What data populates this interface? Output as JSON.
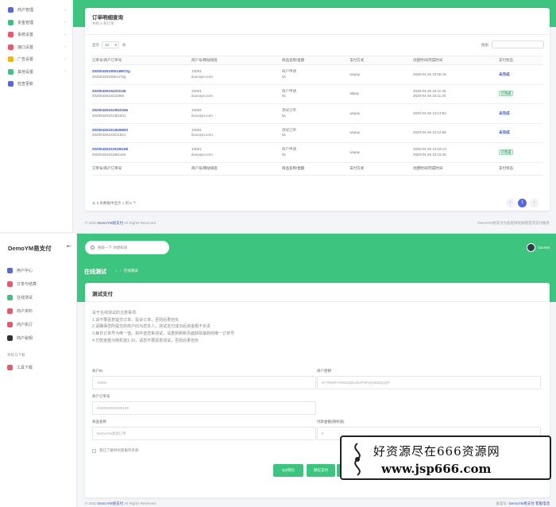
{
  "top_panel": {
    "sidebar": [
      {
        "label": "商户管理",
        "color": "#5867dd"
      },
      {
        "label": "资金管理",
        "color": "#3dc47e"
      },
      {
        "label": "系统设置",
        "color": "#e8596b"
      },
      {
        "label": "接口设置",
        "color": "#e8596b"
      },
      {
        "label": "广告设置",
        "color": "#f4b400"
      },
      {
        "label": "其他设置",
        "color": "#3dc47e"
      },
      {
        "label": "检查更新",
        "color": "#5867dd"
      }
    ],
    "card": {
      "title": "订单明细查询",
      "subtitle": "共有 5 条订单",
      "show_label": "显示",
      "page_size": "10",
      "entries_label": "条",
      "search_label": "搜索:"
    },
    "table": {
      "headers": [
        "订单号/商户订单号",
        "商户号/网站域名",
        "商品名称/金额",
        "支付方式",
        "创建时间/完成时间",
        "支付状态"
      ],
      "rows": [
        {
          "order": "202004261006149672g",
          "merchant_order": "2020042610061472g",
          "merchant": "10001",
          "site": "ilooooyn.com",
          "product": "商户申请",
          "amount": "¥1",
          "method": "wxpay",
          "created": "2020-04-26 10:06:15",
          "finished": "",
          "status": "未完成",
          "status_kind": "red"
        },
        {
          "order": "20200426104223136",
          "merchant_order": "2020042610422565",
          "merchant": "10001",
          "site": "ilooooyn.com",
          "product": "商户申请",
          "amount": "¥1",
          "method": "alipay",
          "created": "2020-04-26 10:11:45",
          "finished": "2020-04-26 10:11:25",
          "status": "已完成",
          "status_kind": "green"
        },
        {
          "order": "202004261013510346",
          "merchant_order": "20200426101351841",
          "merchant": "10002",
          "site": "ilooooyn.com",
          "product": "测试订单",
          "amount": "¥1",
          "method": "wxpay",
          "created": "2020-04-26 10:13:53",
          "finished": "",
          "status": "未完成",
          "status_kind": "blue"
        },
        {
          "order": "202004261014536993",
          "merchant_order": "20200426101511841",
          "merchant": "10002",
          "site": "ilooooyn.com",
          "product": "测试订单",
          "amount": "¥1",
          "method": "wxpay",
          "created": "2020-04-26 10:14:58",
          "finished": "",
          "status": "未完成",
          "status_kind": "blue"
        },
        {
          "order": "202004261019155168",
          "merchant_order": "20200426101851163",
          "merchant": "10001",
          "site": "ilooooyn.com",
          "product": "商户申请",
          "amount": "¥1",
          "method": "wxpay",
          "created": "2020-04-26 10:19:13",
          "finished": "2020-04-26 10:19:28",
          "status": "已完成",
          "status_kind": "green"
        }
      ],
      "footer": [
        "订单号/商户订单号",
        "商户号/网站域名",
        "商品名称/金额",
        "支付方式",
        "创建时间/完成时间",
        "支付状态"
      ]
    },
    "info": "从 5 条数据中显示 1 到 5 个",
    "pager": {
      "prev": "‹",
      "current": "1",
      "next": "›"
    },
    "footer_left_a": "© 2020 ",
    "footer_left_b": "DemoYM易支付",
    "footer_left_c": " All Rights Reserved.",
    "footer_right": "DemoYM易支付为您提供优质稳定的支付服务"
  },
  "bottom_panel": {
    "brand": "DemoYM易支付",
    "collapse_icon": "collapse-icon",
    "sidebar": [
      {
        "label": "用户中心",
        "color": "#5867dd"
      },
      {
        "label": "订单与结算",
        "color": "#e8596b"
      },
      {
        "label": "在线测试",
        "color": "#3dc47e"
      },
      {
        "label": "商户资料",
        "color": "#e8596b"
      },
      {
        "label": "商户执行",
        "color": "#e8596b"
      },
      {
        "label": "商户秘钥",
        "color": "#333333"
      }
    ],
    "group_label": "系统与下载",
    "group_items": [
      {
        "label": "工具下载",
        "color": "#e8596b"
      }
    ],
    "search_placeholder": "搜索一下 你想知道",
    "user_name": "haomei",
    "page_title": "在线测试",
    "breadcrumb": "在线测试",
    "card_title": "测试支付",
    "notes": [
      "关于在线测试的注意事项:",
      "1.请不要恶意提交订单，投诉订单，否则后果自负",
      "2.请确保您所提交的商户ID为您本人，测试支付成功后资金概不负责",
      "3.每日订单号为唯一值，如中途您来测试，请重新刷新页面获取最新的唯一订单号",
      "4.付款金额为随机值1-10，请您不要恶意测试，否则后果自负"
    ],
    "fields": {
      "merchant_id_label": "商户ID",
      "merchant_id_value": "10002",
      "merchant_key_label": "商户密钥",
      "merchant_key_value": "xFVRWRYKRSXQELBVIPWVQXEBQQQT",
      "order_no_label": "商户订单号",
      "order_no_value": "2020042610229139",
      "product_label": "商品名称",
      "product_value": "DemoYM测试订单",
      "amount_label": "付款金额(随机值)",
      "amount_value": "5"
    },
    "agree_text": "我已了解并同意服务条款",
    "buttons": [
      {
        "label": "QQ钱包",
        "color": "#3dc47e"
      },
      {
        "label": "微信支付",
        "color": "#3dc47e"
      },
      {
        "label": "支付宝",
        "color": "#3dc47e"
      }
    ],
    "footer_left_a": "© 2020 ",
    "footer_left_b": "DemoYM易支付",
    "footer_left_c": " All Rights Reserved.",
    "footer_right_a": "备案号: ",
    "footer_right_b": "DemoYM易支付 客服电话"
  },
  "watermark": {
    "line1": "好资源尽在666资源网",
    "line2": "www.jsp666.com"
  }
}
